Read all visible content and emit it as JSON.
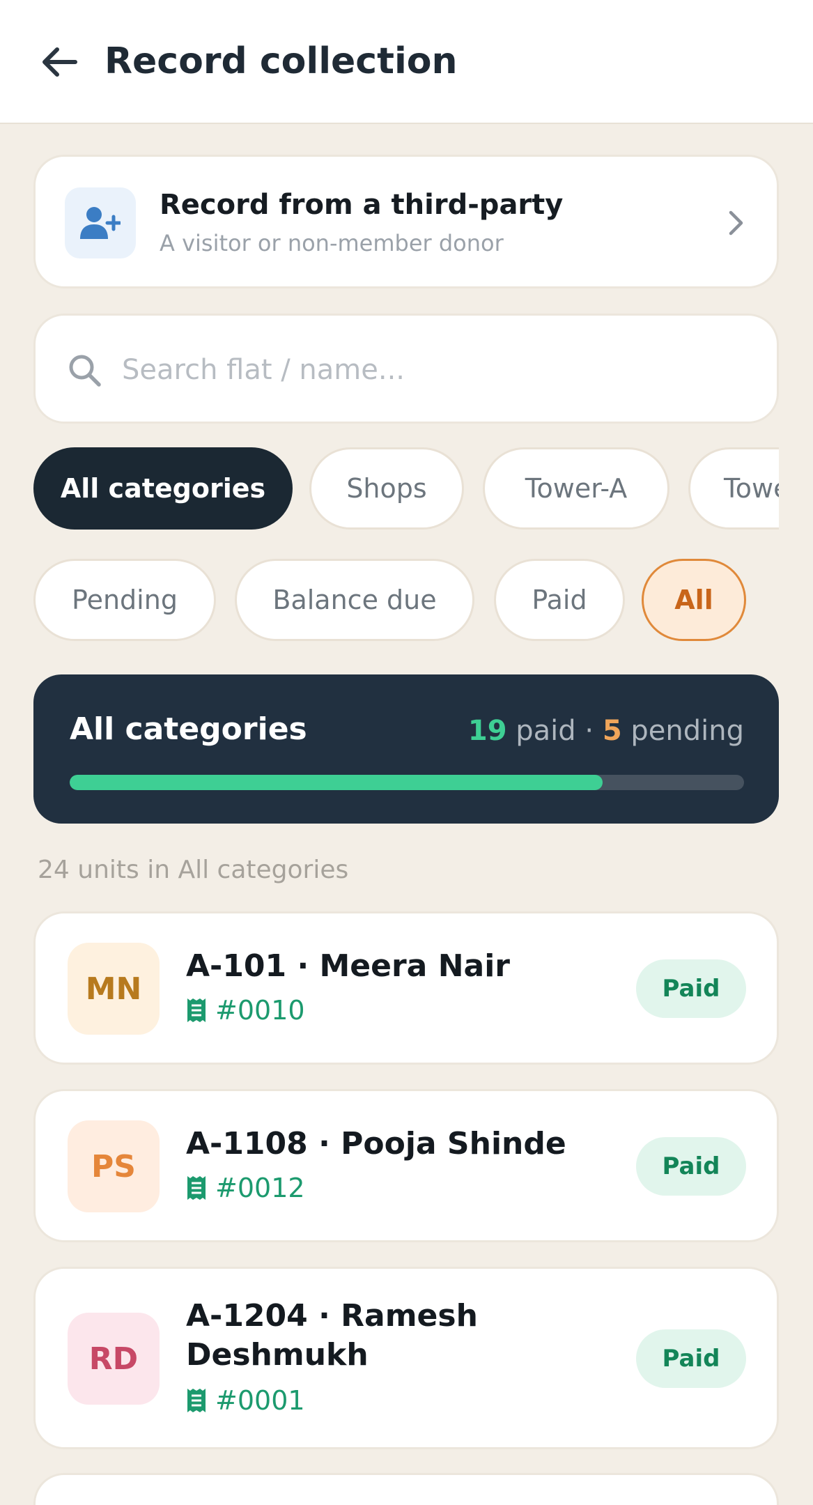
{
  "header": {
    "title": "Record collection"
  },
  "third_party": {
    "title": "Record from a third-party",
    "subtitle": "A visitor or non-member donor"
  },
  "search": {
    "placeholder": "Search flat / name..."
  },
  "category_chips": [
    "All categories",
    "Shops",
    "Tower-A",
    "Tower-B"
  ],
  "status_chips": [
    "Pending",
    "Balance due",
    "Paid",
    "All"
  ],
  "summary": {
    "title": "All categories",
    "paid_count": "19",
    "paid_label": "paid",
    "separator": "·",
    "pending_count": "5",
    "pending_label": "pending",
    "progress_fraction": 0.79
  },
  "units_label": "24 units in All categories",
  "members": [
    {
      "initials": "MN",
      "name": "A-101 · Meera Nair",
      "receipt": "#0010",
      "status": "Paid",
      "avatar_bg": "#FEF1DF",
      "avatar_fg": "#B77A1E"
    },
    {
      "initials": "PS",
      "name": "A-1108 · Pooja Shinde",
      "receipt": "#0012",
      "status": "Paid",
      "avatar_bg": "#FFEDE0",
      "avatar_fg": "#E5863A"
    },
    {
      "initials": "RD",
      "name": "A-1204 · Ramesh Deshmukh",
      "receipt": "#0001",
      "status": "Paid",
      "avatar_bg": "#FCE6EC",
      "avatar_fg": "#C74866"
    }
  ],
  "colors": {
    "accent_dark": "#1B2833",
    "accent_orange": "#E0893A",
    "paid_green": "#3ECF94",
    "pending_orange": "#F0A55A"
  },
  "icons": {
    "back": "arrow-left-icon",
    "third_party": "user-plus-icon",
    "chevron": "chevron-right-icon",
    "search": "search-icon",
    "receipt": "receipt-icon"
  }
}
